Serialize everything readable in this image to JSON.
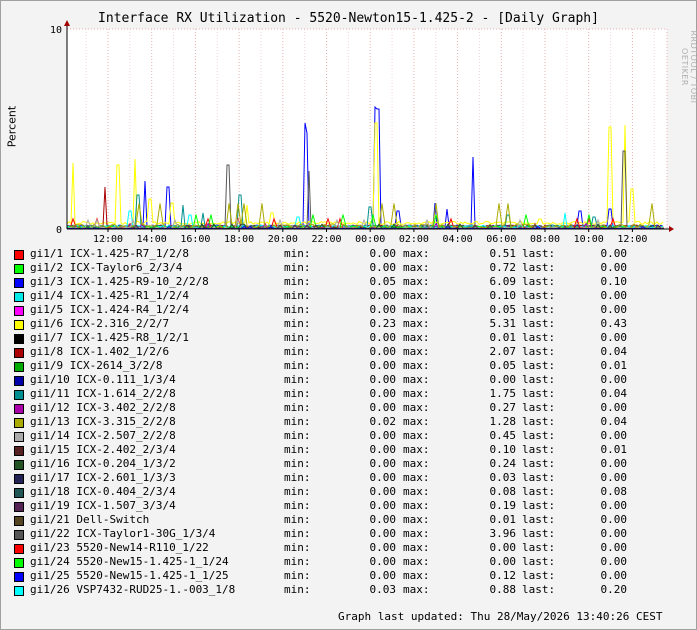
{
  "chart_data": {
    "type": "line",
    "title": "Interface RX Utilization - 5520-Newton15-1.425-2 - [Daily Graph]",
    "ylabel": "Percent",
    "xlabel": "",
    "ylim": [
      0,
      10
    ],
    "y_ticks": [
      "0",
      "10"
    ],
    "x_ticks": [
      "12:00",
      "14:00",
      "16:00",
      "18:00",
      "20:00",
      "22:00",
      "00:00",
      "02:00",
      "04:00",
      "06:00",
      "08:00",
      "10:00",
      "12:00"
    ],
    "grid": true,
    "legend_placement": "bottom",
    "series": [
      {
        "name": "gi1/1 ICX-1.425-R7_1/2/8",
        "color": "#ff0000",
        "min": "0.00",
        "max": "0.51",
        "last": "0.00"
      },
      {
        "name": "gi1/2 ICX-Taylor6_2/3/4",
        "color": "#00ff00",
        "min": "0.00",
        "max": "0.72",
        "last": "0.00"
      },
      {
        "name": "gi1/3 ICX-1.425-R9-10_2/2/8",
        "color": "#0000ff",
        "min": "0.05",
        "max": "6.09",
        "last": "0.10"
      },
      {
        "name": "gi1/4 ICX-1.425-R1_1/2/4",
        "color": "#00e8e8",
        "min": "0.00",
        "max": "0.10",
        "last": "0.00"
      },
      {
        "name": "gi1/5 ICX-1.424-R4_1/2/4",
        "color": "#ff00ff",
        "min": "0.00",
        "max": "0.05",
        "last": "0.00"
      },
      {
        "name": "gi1/6 ICX-2.316_2/2/7",
        "color": "#ffff00",
        "min": "0.23",
        "max": "5.31",
        "last": "0.43"
      },
      {
        "name": "gi1/7 ICX-1.425-R8_1/2/1",
        "color": "#000000",
        "min": "0.00",
        "max": "0.01",
        "last": "0.00"
      },
      {
        "name": "gi1/8 ICX-1.402_1/2/6",
        "color": "#aa0000",
        "min": "0.00",
        "max": "2.07",
        "last": "0.04"
      },
      {
        "name": "gi1/9 ICX-2614_3/2/8",
        "color": "#00aa00",
        "min": "0.00",
        "max": "0.05",
        "last": "0.01"
      },
      {
        "name": "gi1/10 ICX-0.111_1/3/4",
        "color": "#0000aa",
        "min": "0.00",
        "max": "0.00",
        "last": "0.00"
      },
      {
        "name": "gi1/11 ICX-1.614_2/2/8",
        "color": "#008f8f",
        "min": "0.00",
        "max": "1.75",
        "last": "0.04"
      },
      {
        "name": "gi1/12 ICX-3.402_2/2/8",
        "color": "#aa00aa",
        "min": "0.00",
        "max": "0.27",
        "last": "0.00"
      },
      {
        "name": "gi1/13 ICX-3.315_2/2/8",
        "color": "#aaaa00",
        "min": "0.02",
        "max": "1.28",
        "last": "0.04"
      },
      {
        "name": "gi1/14 ICX-2.507_2/2/8",
        "color": "#aaaaaa",
        "min": "0.00",
        "max": "0.45",
        "last": "0.00"
      },
      {
        "name": "gi1/15 ICX-2.402_2/3/4",
        "color": "#552222",
        "min": "0.00",
        "max": "0.10",
        "last": "0.01"
      },
      {
        "name": "gi1/16 ICX-0.204_1/3/2",
        "color": "#225522",
        "min": "0.00",
        "max": "0.24",
        "last": "0.00"
      },
      {
        "name": "gi1/17 ICX-2.601_1/3/3",
        "color": "#222255",
        "min": "0.00",
        "max": "0.03",
        "last": "0.00"
      },
      {
        "name": "gi1/18 ICX-0.404_2/3/4",
        "color": "#225555",
        "min": "0.00",
        "max": "0.08",
        "last": "0.08"
      },
      {
        "name": "gi1/19 ICX-1.507_3/3/4",
        "color": "#552255",
        "min": "0.00",
        "max": "0.19",
        "last": "0.00"
      },
      {
        "name": "gi1/21 Dell-Switch",
        "color": "#554422",
        "min": "0.00",
        "max": "0.01",
        "last": "0.00"
      },
      {
        "name": "gi1/22 ICX-Taylor1-30G_1/3/4",
        "color": "#555555",
        "min": "0.00",
        "max": "3.96",
        "last": "0.00"
      },
      {
        "name": "gi1/23 5520-New14-R110_1/22",
        "color": "#ff0000",
        "min": "0.00",
        "max": "0.00",
        "last": "0.00"
      },
      {
        "name": "gi1/24 5520-New15-1.425-1_1/24",
        "color": "#00ff00",
        "min": "0.00",
        "max": "0.00",
        "last": "0.00"
      },
      {
        "name": "gi1/25 5520-New15-1.425-1_1/25",
        "color": "#0000ff",
        "min": "0.00",
        "max": "0.12",
        "last": "0.00"
      },
      {
        "name": "gi1/26 VSP7432-RUD25-1.-003_1/8",
        "color": "#00ffff",
        "min": "0.03",
        "max": "0.88",
        "last": "0.20"
      }
    ]
  },
  "labels": {
    "min": "min:",
    "max": "max:",
    "last": "last:"
  },
  "watermark": "RRDTOOL / TOBI OETIKER",
  "updated": "Graph last updated: Thu 28/May/2026 13:40:26 CEST"
}
